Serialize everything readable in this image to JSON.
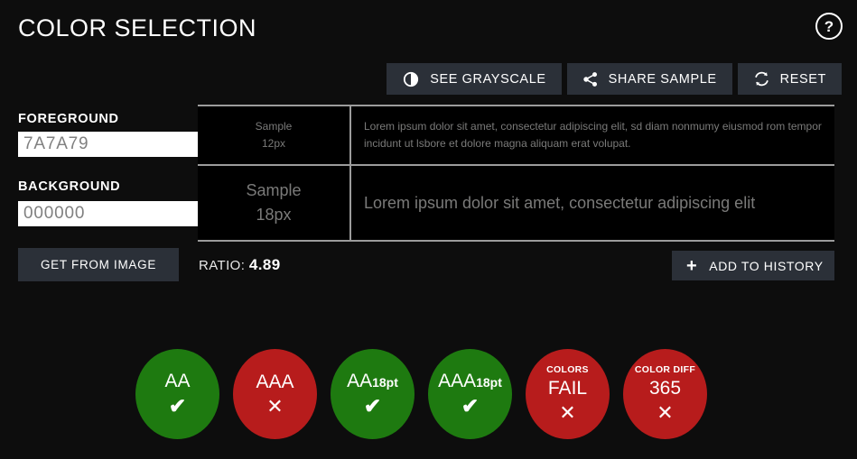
{
  "header": {
    "title": "COLOR SELECTION",
    "help_icon": "help-circle-icon",
    "help_glyph": "?"
  },
  "toolbar": {
    "buttons": [
      {
        "label": "SEE GRAYSCALE",
        "icon": "contrast-icon",
        "name": "see-grayscale-button"
      },
      {
        "label": "SHARE SAMPLE",
        "icon": "share-icon",
        "name": "share-sample-button"
      },
      {
        "label": "RESET",
        "icon": "refresh-icon",
        "name": "reset-button"
      }
    ]
  },
  "sidebar": {
    "foreground_label": "FOREGROUND",
    "foreground_value": "7A7A79",
    "foreground_placeholder": "7A7A79",
    "background_label": "BACKGROUND",
    "background_value": "000000",
    "background_placeholder": "000000",
    "get_from_image_label": "GET FROM IMAGE",
    "palette_icon": "color-palette-icon"
  },
  "sample": {
    "rows": [
      {
        "size_label": "Sample",
        "size_value": "12px",
        "text": "Lorem ipsum dolor sit amet, consectetur adipiscing elit, sd diam nonmumy eiusmod rom tempor incidunt ut lsbore et dolore magna aliquam erat volupat."
      },
      {
        "size_label": "Sample",
        "size_value": "18px",
        "text": "Lorem ipsum dolor sit amet, consectetur adipiscing elit"
      }
    ],
    "foreground_color": "#7a7a79",
    "background_color": "#000000"
  },
  "results": {
    "ratio_label": "RATIO:",
    "ratio_value": "4.89",
    "add_to_history_label": "ADD TO HISTORY",
    "add_icon": "plus-icon"
  },
  "badges": [
    {
      "name": "badge-aa",
      "caption": "",
      "main": "AA",
      "sub": "",
      "mark": "✔",
      "status": "pass",
      "color": "#1e7a10"
    },
    {
      "name": "badge-aaa",
      "caption": "",
      "main": "AAA",
      "sub": "",
      "mark": "✕",
      "status": "fail",
      "color": "#b71c1c"
    },
    {
      "name": "badge-aa-18pt",
      "caption": "",
      "main": "AA",
      "sub": "18pt",
      "mark": "✔",
      "status": "pass",
      "color": "#1e7a10"
    },
    {
      "name": "badge-aaa-18pt",
      "caption": "",
      "main": "AAA",
      "sub": "18pt",
      "mark": "✔",
      "status": "pass",
      "color": "#1e7a10"
    },
    {
      "name": "badge-colors",
      "caption": "COLORS",
      "main": "FAIL",
      "sub": "",
      "mark": "✕",
      "status": "fail",
      "color": "#b71c1c"
    },
    {
      "name": "badge-color-diff",
      "caption": "COLOR DIFF",
      "main": "365",
      "sub": "",
      "mark": "✕",
      "status": "fail",
      "color": "#b71c1c"
    }
  ],
  "theme": {
    "page_background": "#0d0d0d",
    "button_background": "#2b3038",
    "divider": "#9c9c9c",
    "pass_color": "#1e7a10",
    "fail_color": "#b71c1c"
  },
  "palette_swatches": [
    "#c62828",
    "#8e0000",
    "#e07b39",
    "#f2a33c",
    "#e53935",
    "#c0392b",
    "#f0544f",
    "#c8d44a",
    "#ef5350",
    "#ff7043",
    "#8bc34a",
    "#7cb342",
    "#b0bec5",
    "#7e57c2",
    "#26c6da",
    "#ff4fd8",
    "#cfd8dc",
    "#000000",
    "#5d4037",
    "#ef6c00"
  ]
}
